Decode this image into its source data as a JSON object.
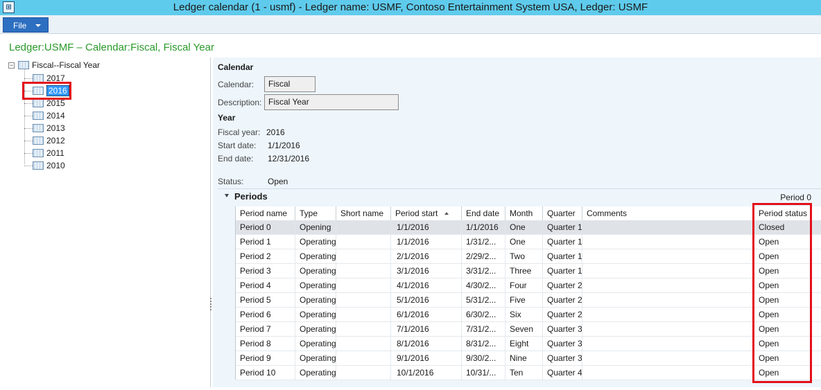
{
  "window": {
    "app_icon": "ledger-app-icon",
    "title": "Ledger calendar (1 - usmf) - Ledger name: USMF, Contoso Entertainment System USA, Ledger: USMF"
  },
  "menu": {
    "file_label": "File"
  },
  "caption": "Ledger:USMF – Calendar:Fiscal, Fiscal Year",
  "tree": {
    "root_expander": "−",
    "root": "Fiscal--Fiscal Year",
    "years": [
      "2017",
      "2016",
      "2015",
      "2014",
      "2013",
      "2012",
      "2011",
      "2010"
    ],
    "selected": "2016"
  },
  "calendar_section": {
    "heading": "Calendar",
    "calendar_label": "Calendar:",
    "calendar_value": "Fiscal",
    "description_label": "Description:",
    "description_value": "Fiscal Year"
  },
  "year_section": {
    "heading": "Year",
    "fiscal_year_label": "Fiscal year:",
    "fiscal_year_value": "2016",
    "start_date_label": "Start date:",
    "start_date_value": "1/1/2016",
    "end_date_label": "End date:",
    "end_date_value": "12/31/2016",
    "status_label": "Status:",
    "status_value": "Open"
  },
  "periods": {
    "heading": "Periods",
    "current_period": "Period 0",
    "columns": [
      "Period name",
      "Type",
      "Short name",
      "Period start",
      "End date",
      "Month",
      "Quarter",
      "Comments",
      "Period status"
    ],
    "rows": [
      [
        "Period 0",
        "Opening",
        "",
        "1/1/2016",
        "1/1/2016",
        "One",
        "Quarter 1",
        "",
        "Closed"
      ],
      [
        "Period 1",
        "Operating",
        "",
        "1/1/2016",
        "1/31/2...",
        "One",
        "Quarter 1",
        "",
        "Open"
      ],
      [
        "Period 2",
        "Operating",
        "",
        "2/1/2016",
        "2/29/2...",
        "Two",
        "Quarter 1",
        "",
        "Open"
      ],
      [
        "Period 3",
        "Operating",
        "",
        "3/1/2016",
        "3/31/2...",
        "Three",
        "Quarter 1",
        "",
        "Open"
      ],
      [
        "Period 4",
        "Operating",
        "",
        "4/1/2016",
        "4/30/2...",
        "Four",
        "Quarter 2",
        "",
        "Open"
      ],
      [
        "Period 5",
        "Operating",
        "",
        "5/1/2016",
        "5/31/2...",
        "Five",
        "Quarter 2",
        "",
        "Open"
      ],
      [
        "Period 6",
        "Operating",
        "",
        "6/1/2016",
        "6/30/2...",
        "Six",
        "Quarter 2",
        "",
        "Open"
      ],
      [
        "Period 7",
        "Operating",
        "",
        "7/1/2016",
        "7/31/2...",
        "Seven",
        "Quarter 3",
        "",
        "Open"
      ],
      [
        "Period 8",
        "Operating",
        "",
        "8/1/2016",
        "8/31/2...",
        "Eight",
        "Quarter 3",
        "",
        "Open"
      ],
      [
        "Period 9",
        "Operating",
        "",
        "9/1/2016",
        "9/30/2...",
        "Nine",
        "Quarter 3",
        "",
        "Open"
      ],
      [
        "Period 10",
        "Operating",
        "",
        "10/1/2016",
        "10/31/...",
        "Ten",
        "Quarter 4",
        "",
        "Open"
      ]
    ]
  },
  "colors": {
    "accent": "#2d6fc0",
    "titlebar": "#5fcbec",
    "caption": "#2a9a2a",
    "highlight_box": "#e3101a"
  }
}
